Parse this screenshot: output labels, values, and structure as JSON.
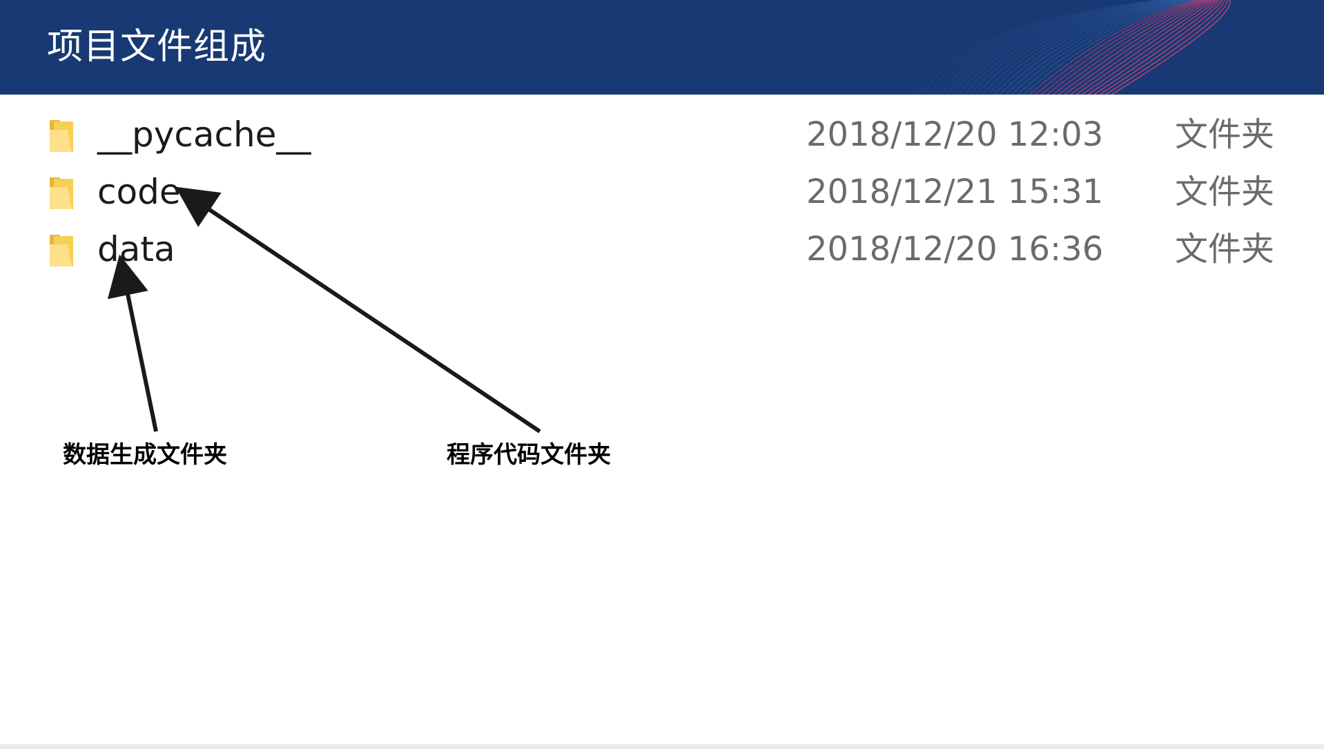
{
  "header": {
    "title": "项目文件组成",
    "background_color": "#183973",
    "accent_color": "#e0457b"
  },
  "files": [
    {
      "name": "__pycache__",
      "modified": "2018/12/20 12:03",
      "type": "文件夹",
      "icon": "folder-icon"
    },
    {
      "name": "code",
      "modified": "2018/12/21 15:31",
      "type": "文件夹",
      "icon": "folder-icon"
    },
    {
      "name": "data",
      "modified": "2018/12/20 16:36",
      "type": "文件夹",
      "icon": "folder-icon"
    }
  ],
  "annotations": {
    "data_label": "数据生成文件夹",
    "code_label": "程序代码文件夹"
  },
  "colors": {
    "folder": "#f4c542",
    "folder_light": "#ffe28a",
    "text_primary": "#1b1b1b",
    "text_secondary": "#6b6b6b",
    "arrow": "#1a1a1a"
  }
}
